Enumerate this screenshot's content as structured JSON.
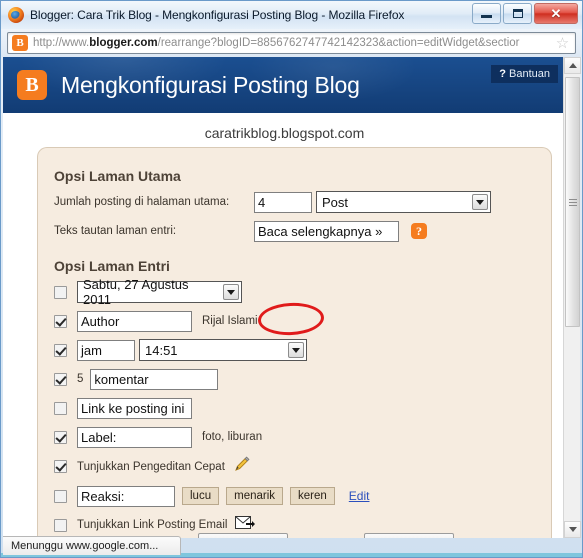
{
  "window": {
    "title": "Blogger: Cara Trik Blog - Mengkonfigurasi Posting Blog - Mozilla Firefox",
    "firefox_icon": "firefox-icon",
    "minimize_label": "–",
    "maximize_label": "□",
    "close_label": "✕"
  },
  "urlbar": {
    "site_icon_letter": "B",
    "url_prefix": "http://www.",
    "url_domain": "blogger.com",
    "url_suffix": "/rearrange?blogID=8856762747742142323&action=editWidget&sectior",
    "star_icon": "☆"
  },
  "header": {
    "logo_letter": "B",
    "title": "Mengkonfigurasi Posting Blog",
    "help_mark": "?",
    "help_label": "Bantuan"
  },
  "page": {
    "blog_name": "caratrikblog.blogspot.com"
  },
  "main_page_options": {
    "section_title": "Opsi Laman Utama",
    "posts_count_label": "Jumlah posting di halaman utama:",
    "posts_count_value": "4",
    "posts_unit_value": "Post",
    "jump_link_label": "Teks tautan laman entri:",
    "jump_link_value": "Baca selengkapnya »",
    "help_mark": "?"
  },
  "entry_page_options": {
    "section_title": "Opsi Laman Entri",
    "rows": [
      {
        "checked": false,
        "field": "Sabtu, 27 Agustus 2011",
        "type": "select",
        "side": ""
      },
      {
        "checked": true,
        "field": "Author",
        "type": "input",
        "side": "Rijal Islami"
      },
      {
        "checked": true,
        "field": "jam",
        "type": "input_plus_select",
        "select_value": "14:51",
        "side": ""
      },
      {
        "checked": true,
        "prefix": "5",
        "field": "komentar",
        "type": "input",
        "side": ""
      },
      {
        "checked": false,
        "field": "Link ke posting ini",
        "type": "input",
        "side": ""
      },
      {
        "checked": true,
        "field": "Label:",
        "type": "input",
        "side": "foto, liburan"
      },
      {
        "checked": true,
        "field": "Tunjukkan Pengeditan Cepat",
        "type": "text_with_pencil",
        "side": ""
      },
      {
        "checked": false,
        "field": "Reaksi:",
        "type": "reactions",
        "side": ""
      },
      {
        "checked": false,
        "field": "Tunjukkan Link Posting Email",
        "type": "text_with_envelope",
        "side": ""
      }
    ],
    "reaction_buttons": [
      "lucu",
      "menarik",
      "keren"
    ],
    "reaction_edit_label": "Edit"
  },
  "annotation": {
    "shape": "red-ellipse",
    "color": "#e01b1b",
    "targets": "posts_count_value"
  },
  "statusbar": {
    "text": "Menunggu www.google.com..."
  },
  "colors": {
    "header_blue": "#184b8c",
    "blogger_orange": "#f57c1f",
    "panel_cream": "#f6ece0",
    "annotation_red": "#e01b1b",
    "link_blue": "#2b4fbd"
  },
  "google_stripe": [
    "#d93025",
    "#1a73e8",
    "#188038",
    "#fbbc04"
  ]
}
